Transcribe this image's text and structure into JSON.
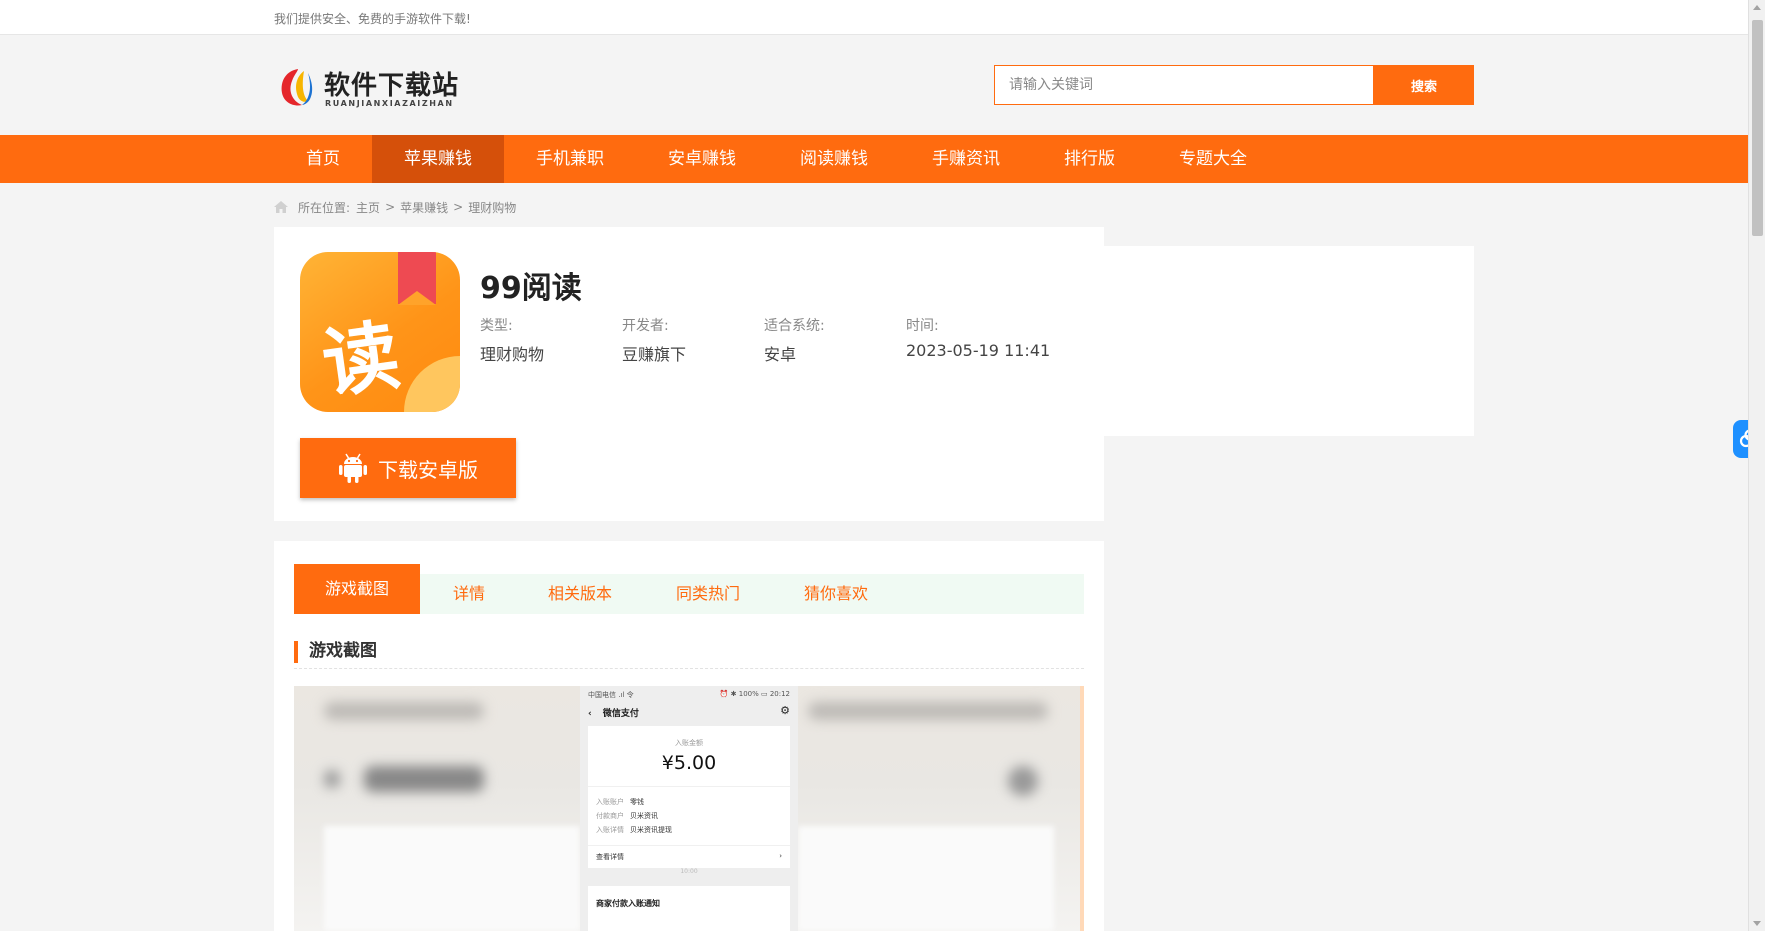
{
  "topbar": {
    "notice": "我们提供安全、免费的手游软件下载!"
  },
  "header": {
    "logo": {
      "name": "软件下载站",
      "sub": "RUANJIANXIAZAIZHAN"
    },
    "search": {
      "placeholder": "请输入关键词",
      "button_label": "搜索"
    }
  },
  "nav": {
    "items": [
      {
        "label": "首页",
        "active": false
      },
      {
        "label": "苹果赚钱",
        "active": true
      },
      {
        "label": "手机兼职",
        "active": false
      },
      {
        "label": "安卓赚钱",
        "active": false
      },
      {
        "label": "阅读赚钱",
        "active": false
      },
      {
        "label": "手赚资讯",
        "active": false
      },
      {
        "label": "排行版",
        "active": false
      },
      {
        "label": "专题大全",
        "active": false
      }
    ]
  },
  "breadcrumb": {
    "prefix": "所在位置:",
    "items": [
      "主页",
      "苹果赚钱",
      "理财购物"
    ],
    "separator": ">"
  },
  "app": {
    "icon_glyph": "读",
    "title": "99阅读",
    "meta": [
      {
        "key": "类型:",
        "value": "理财购物"
      },
      {
        "key": "开发者:",
        "value": "豆赚旗下"
      },
      {
        "key": "适合系统:",
        "value": "安卓"
      },
      {
        "key": "时间:",
        "value": "2023-05-19 11:41"
      }
    ],
    "download_label": "下载安卓版"
  },
  "tabs": [
    {
      "label": "游戏截图",
      "active": true
    },
    {
      "label": "详情",
      "active": false
    },
    {
      "label": "相关版本",
      "active": false
    },
    {
      "label": "同类热门",
      "active": false
    },
    {
      "label": "猜你喜欢",
      "active": false
    }
  ],
  "section_title": "游戏截图",
  "screenshot": {
    "status_left": "中国电信 .ıl 令",
    "status_right": "⏰ ✱ 100% ▭ 20:12",
    "title": "微信支付",
    "amount_label": "入账金额",
    "amount": "¥5.00",
    "rows": [
      {
        "key": "入账账户",
        "value": "零钱"
      },
      {
        "key": "付款商户",
        "value": "贝米资讯"
      },
      {
        "key": "入账详情",
        "value": "贝米资讯提现"
      }
    ],
    "detail_label": "查看详情",
    "time": "10:00",
    "notice": "商家付款入账通知"
  },
  "colors": {
    "accent": "#ff6b0f",
    "nav_active": "#d5500a",
    "tab_strip": "#f0faf3",
    "widget": "#1e90ff"
  }
}
